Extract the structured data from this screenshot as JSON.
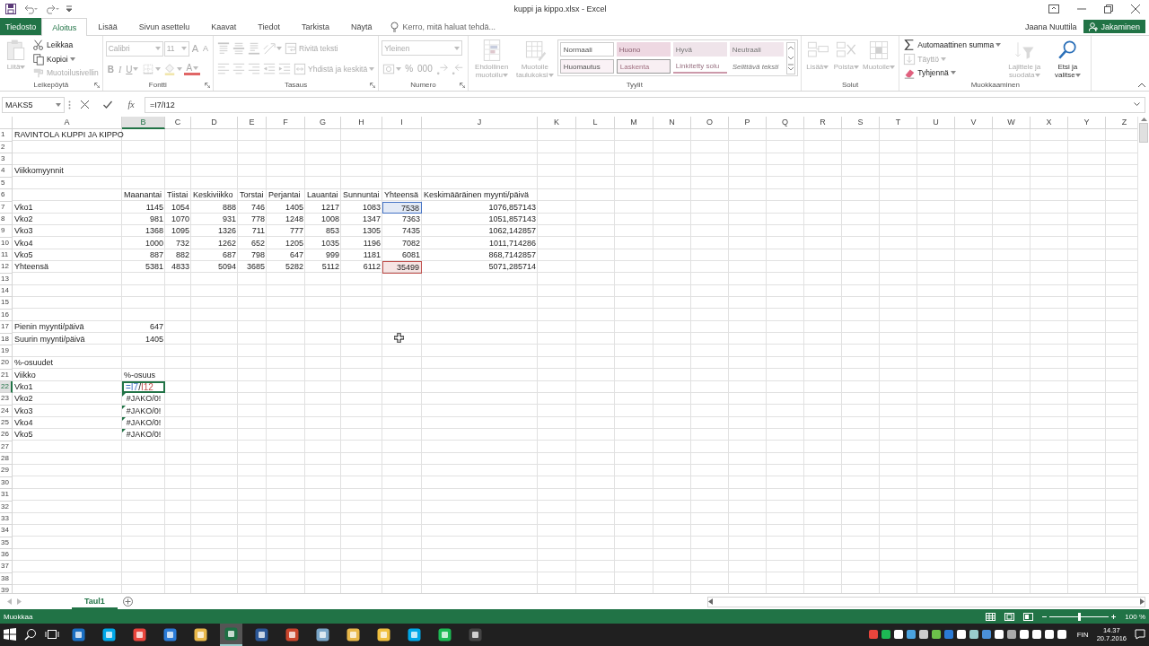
{
  "window": {
    "title": "kuppi ja kippo.xlsx - Excel",
    "user": "Jaana Nuuttila",
    "share_button": "Jakaminen"
  },
  "ribbon_tabs": [
    {
      "label": "Tiedosto",
      "kind": "file",
      "selected": false
    },
    {
      "label": "Aloitus",
      "kind": "tab",
      "selected": true
    },
    {
      "label": "Lisää",
      "kind": "tab",
      "selected": false
    },
    {
      "label": "Sivun asettelu",
      "kind": "tab",
      "selected": false
    },
    {
      "label": "Kaavat",
      "kind": "tab",
      "selected": false
    },
    {
      "label": "Tiedot",
      "kind": "tab",
      "selected": false
    },
    {
      "label": "Tarkista",
      "kind": "tab",
      "selected": false
    },
    {
      "label": "Näytä",
      "kind": "tab",
      "selected": false
    }
  ],
  "tell_me": {
    "placeholder": "Kerro, mitä haluat tehdä..."
  },
  "ribbon_groups": [
    {
      "label": "Leikepöytä",
      "launcher": true,
      "items": [
        {
          "kind": "large",
          "label": "Liitä",
          "disabled": true,
          "dropdown": true
        },
        {
          "kind": "stack",
          "items": [
            {
              "kind": "button",
              "label": "Leikkaa",
              "disabled": false
            },
            {
              "kind": "button",
              "label": "Kopioi",
              "disabled": false,
              "dropdown": true
            },
            {
              "kind": "button",
              "label": "Muotoilusivellin",
              "disabled": true
            }
          ]
        }
      ]
    },
    {
      "label": "Fontti",
      "launcher": true,
      "items": [
        {
          "kind": "stack",
          "items": [
            {
              "kind": "line",
              "items": [
                {
                  "kind": "field",
                  "value": "Calibri",
                  "disabled": true
                },
                {
                  "kind": "field",
                  "value": "11",
                  "disabled": true
                },
                {
                  "kind": "glyph",
                  "text": "A",
                  "disabled": true
                },
                {
                  "kind": "glyph",
                  "text": "A",
                  "disabled": true
                }
              ]
            },
            {
              "kind": "line",
              "items": [
                {
                  "kind": "glyph",
                  "text": "B",
                  "disabled": true
                },
                {
                  "kind": "glyph",
                  "text": "I",
                  "disabled": true
                },
                {
                  "kind": "glyph",
                  "text": "U",
                  "disabled": true,
                  "dropdown": true
                },
                {
                  "kind": "icon",
                  "disabled": true,
                  "dropdown": true
                },
                {
                  "kind": "icon",
                  "disabled": true,
                  "dropdown": true
                },
                {
                  "kind": "glyph",
                  "text": "A",
                  "disabled": true,
                  "dropdown": true
                }
              ]
            }
          ]
        }
      ]
    },
    {
      "label": "Tasaus",
      "launcher": true,
      "items": [
        {
          "kind": "stack",
          "items": [
            {
              "kind": "line",
              "items": [
                {
                  "kind": "icon",
                  "disabled": true
                },
                {
                  "kind": "icon",
                  "disabled": true
                },
                {
                  "kind": "icon",
                  "disabled": true
                },
                {
                  "kind": "icon",
                  "disabled": true,
                  "dropdown": true
                },
                {
                  "kind": "button",
                  "label": "Rivitä teksti",
                  "disabled": true
                }
              ]
            },
            {
              "kind": "line",
              "items": [
                {
                  "kind": "icon",
                  "disabled": true
                },
                {
                  "kind": "icon",
                  "disabled": true
                },
                {
                  "kind": "icon",
                  "disabled": true
                },
                {
                  "kind": "icon",
                  "disabled": true
                },
                {
                  "kind": "icon",
                  "disabled": true
                },
                {
                  "kind": "button",
                  "label": "Yhdistä ja keskitä",
                  "disabled": true,
                  "dropdown": true
                }
              ]
            }
          ]
        }
      ]
    },
    {
      "label": "Numero",
      "launcher": true,
      "items": [
        {
          "kind": "stack",
          "items": [
            {
              "kind": "line",
              "items": [
                {
                  "kind": "field",
                  "value": "Yleinen",
                  "disabled": true
                }
              ]
            },
            {
              "kind": "line",
              "items": [
                {
                  "kind": "icon",
                  "disabled": true,
                  "dropdown": true
                },
                {
                  "kind": "glyph",
                  "text": "%",
                  "disabled": true
                },
                {
                  "kind": "glyph",
                  "text": "000",
                  "disabled": true
                },
                {
                  "kind": "icon",
                  "disabled": true
                },
                {
                  "kind": "icon",
                  "disabled": true
                }
              ]
            }
          ]
        }
      ]
    },
    {
      "label": "Tyylit",
      "items": [
        {
          "kind": "large",
          "label": "Ehdollinen muotoilu",
          "disabled": true,
          "dropdown": true
        },
        {
          "kind": "large",
          "label": "Muotoile taulukoksi",
          "disabled": true,
          "dropdown": true
        },
        {
          "kind": "gallery",
          "styles": [
            {
              "kind": "normal",
              "label": "Normaali"
            },
            {
              "kind": "bad",
              "label": "Huono"
            },
            {
              "kind": "good",
              "label": "Hyvä"
            },
            {
              "kind": "neutral",
              "label": "Neutraali"
            },
            {
              "kind": "note",
              "label": "Huomautus"
            },
            {
              "kind": "calc",
              "label": "Laskenta"
            },
            {
              "kind": "linked",
              "label": "Linkitetty solu"
            },
            {
              "kind": "explanatory",
              "label": "Selittävä teksti"
            }
          ]
        }
      ]
    },
    {
      "label": "Solut",
      "items": [
        {
          "kind": "large",
          "label": "Lisää",
          "disabled": true,
          "dropdown": true
        },
        {
          "kind": "large",
          "label": "Poista",
          "disabled": true,
          "dropdown": true
        },
        {
          "kind": "large",
          "label": "Muotoile",
          "disabled": true,
          "dropdown": true
        }
      ]
    },
    {
      "label": "Muokkaaminen",
      "items": [
        {
          "kind": "stack",
          "items": [
            {
              "kind": "button",
              "label": "Automaattinen summa",
              "disabled": false,
              "dropdown": true
            },
            {
              "kind": "button",
              "label": "Täyttö",
              "disabled": true,
              "dropdown": true
            },
            {
              "kind": "button",
              "label": "Tyhjennä",
              "disabled": false,
              "dropdown": true
            }
          ]
        },
        {
          "kind": "large",
          "label": "Lajittele ja suodata",
          "disabled": true,
          "dropdown": true
        },
        {
          "kind": "large",
          "label": "Etsi ja valitse",
          "disabled": false,
          "dropdown": true
        }
      ]
    }
  ],
  "formula_bar": {
    "name_box": "MAKS5",
    "function_button": "fx",
    "formula": "=I7/I12"
  },
  "columns": [
    {
      "label": "A",
      "selected": false
    },
    {
      "label": "B",
      "selected": true
    },
    {
      "label": "C",
      "selected": false
    },
    {
      "label": "D",
      "selected": false
    },
    {
      "label": "E",
      "selected": false
    },
    {
      "label": "F",
      "selected": false
    },
    {
      "label": "G",
      "selected": false
    },
    {
      "label": "H",
      "selected": false
    },
    {
      "label": "I",
      "selected": false
    },
    {
      "label": "J",
      "selected": false
    },
    {
      "label": "K",
      "selected": false
    },
    {
      "label": "L",
      "selected": false
    },
    {
      "label": "M",
      "selected": false
    },
    {
      "label": "N",
      "selected": false
    },
    {
      "label": "O",
      "selected": false
    },
    {
      "label": "P",
      "selected": false
    },
    {
      "label": "Q",
      "selected": false
    },
    {
      "label": "R",
      "selected": false
    },
    {
      "label": "S",
      "selected": false
    },
    {
      "label": "T",
      "selected": false
    },
    {
      "label": "U",
      "selected": false
    },
    {
      "label": "V",
      "selected": false
    },
    {
      "label": "W",
      "selected": false
    },
    {
      "label": "X",
      "selected": false
    },
    {
      "label": "Y",
      "selected": false
    },
    {
      "label": "Z",
      "selected": false
    }
  ],
  "rows": [
    {
      "number": "1",
      "selected": false,
      "cells": [
        {
          "kind": "text",
          "text": "RAVINTOLA KUPPI JA KIPPO"
        }
      ]
    },
    {
      "number": "2",
      "selected": false
    },
    {
      "number": "3",
      "selected": false
    },
    {
      "number": "4",
      "selected": false,
      "cells": [
        {
          "kind": "text",
          "text": "Viikkomyynnit"
        }
      ]
    },
    {
      "number": "5",
      "selected": false
    },
    {
      "number": "6",
      "selected": false,
      "cells": [
        null,
        {
          "kind": "text",
          "text": "Maanantai"
        },
        {
          "kind": "text",
          "text": "Tiistai"
        },
        {
          "kind": "text",
          "text": "Keskiviikko"
        },
        {
          "kind": "text",
          "text": "Torstai"
        },
        {
          "kind": "text",
          "text": "Perjantai"
        },
        {
          "kind": "text",
          "text": "Lauantai"
        },
        {
          "kind": "text",
          "text": "Sunnuntai"
        },
        {
          "kind": "text",
          "text": "Yhteensä"
        },
        {
          "kind": "text",
          "text": "Keskimääräinen myynti/päivä"
        }
      ]
    },
    {
      "number": "7",
      "selected": false,
      "cells": [
        {
          "kind": "text",
          "text": "Vko1"
        },
        {
          "kind": "number",
          "text": "1145"
        },
        {
          "kind": "number",
          "text": "1054"
        },
        {
          "kind": "number",
          "text": "888"
        },
        {
          "kind": "number",
          "text": "746"
        },
        {
          "kind": "number",
          "text": "1405"
        },
        {
          "kind": "number",
          "text": "1217"
        },
        {
          "kind": "number",
          "text": "1083"
        },
        {
          "kind": "number",
          "text": "7538",
          "color": "#4472c4"
        },
        {
          "kind": "number",
          "text": "1076,857143"
        }
      ]
    },
    {
      "number": "8",
      "selected": false,
      "cells": [
        {
          "kind": "text",
          "text": "Vko2"
        },
        {
          "kind": "number",
          "text": "981"
        },
        {
          "kind": "number",
          "text": "1070"
        },
        {
          "kind": "number",
          "text": "931"
        },
        {
          "kind": "number",
          "text": "778"
        },
        {
          "kind": "number",
          "text": "1248"
        },
        {
          "kind": "number",
          "text": "1008"
        },
        {
          "kind": "number",
          "text": "1347"
        },
        {
          "kind": "number",
          "text": "7363"
        },
        {
          "kind": "number",
          "text": "1051,857143"
        }
      ]
    },
    {
      "number": "9",
      "selected": false,
      "cells": [
        {
          "kind": "text",
          "text": "Vko3"
        },
        {
          "kind": "number",
          "text": "1368"
        },
        {
          "kind": "number",
          "text": "1095"
        },
        {
          "kind": "number",
          "text": "1326"
        },
        {
          "kind": "number",
          "text": "711"
        },
        {
          "kind": "number",
          "text": "777"
        },
        {
          "kind": "number",
          "text": "853"
        },
        {
          "kind": "number",
          "text": "1305"
        },
        {
          "kind": "number",
          "text": "7435"
        },
        {
          "kind": "number",
          "text": "1062,142857"
        }
      ]
    },
    {
      "number": "10",
      "selected": false,
      "cells": [
        {
          "kind": "text",
          "text": "Vko4"
        },
        {
          "kind": "number",
          "text": "1000"
        },
        {
          "kind": "number",
          "text": "732"
        },
        {
          "kind": "number",
          "text": "1262"
        },
        {
          "kind": "number",
          "text": "652"
        },
        {
          "kind": "number",
          "text": "1205"
        },
        {
          "kind": "number",
          "text": "1035"
        },
        {
          "kind": "number",
          "text": "1196"
        },
        {
          "kind": "number",
          "text": "7082"
        },
        {
          "kind": "number",
          "text": "1011,714286"
        }
      ]
    },
    {
      "number": "11",
      "selected": false,
      "cells": [
        {
          "kind": "text",
          "text": "Vko5"
        },
        {
          "kind": "number",
          "text": "887"
        },
        {
          "kind": "number",
          "text": "882"
        },
        {
          "kind": "number",
          "text": "687"
        },
        {
          "kind": "number",
          "text": "798"
        },
        {
          "kind": "number",
          "text": "647"
        },
        {
          "kind": "number",
          "text": "999"
        },
        {
          "kind": "number",
          "text": "1181"
        },
        {
          "kind": "number",
          "text": "6081"
        },
        {
          "kind": "number",
          "text": "868,7142857"
        }
      ]
    },
    {
      "number": "12",
      "selected": false,
      "cells": [
        {
          "kind": "text",
          "text": "Yhteensä"
        },
        {
          "kind": "number",
          "text": "5381"
        },
        {
          "kind": "number",
          "text": "4833"
        },
        {
          "kind": "number",
          "text": "5094"
        },
        {
          "kind": "number",
          "text": "3685"
        },
        {
          "kind": "number",
          "text": "5282"
        },
        {
          "kind": "number",
          "text": "5112"
        },
        {
          "kind": "number",
          "text": "6112"
        },
        {
          "kind": "number",
          "text": "35499",
          "color": "#c0504d"
        },
        {
          "kind": "number",
          "text": "5071,285714"
        }
      ]
    },
    {
      "number": "13",
      "selected": false
    },
    {
      "number": "14",
      "selected": false
    },
    {
      "number": "15",
      "selected": false
    },
    {
      "number": "16",
      "selected": false
    },
    {
      "number": "17",
      "selected": false,
      "cells": [
        {
          "kind": "text",
          "text": "Pienin myynti/päivä"
        },
        {
          "kind": "number",
          "text": "647"
        }
      ]
    },
    {
      "number": "18",
      "selected": false,
      "cells": [
        {
          "kind": "text",
          "text": "Suurin myynti/päivä"
        },
        {
          "kind": "number",
          "text": "1405"
        }
      ]
    },
    {
      "number": "19",
      "selected": false
    },
    {
      "number": "20",
      "selected": false,
      "cells": [
        {
          "kind": "text",
          "text": "%-osuudet"
        }
      ]
    },
    {
      "number": "21",
      "selected": false,
      "cells": [
        {
          "kind": "text",
          "text": "Viikko"
        },
        {
          "kind": "text",
          "text": "%-osuus"
        }
      ]
    },
    {
      "number": "22",
      "selected": true,
      "cells": [
        {
          "kind": "text",
          "text": "Vko1"
        },
        {
          "kind": "edit",
          "parts": [
            {
              "text": "=I7",
              "color": "#4472c4"
            },
            {
              "text": "/"
            },
            {
              "text": "I12",
              "color": "#c0504d"
            }
          ]
        }
      ]
    },
    {
      "number": "23",
      "selected": false,
      "cells": [
        {
          "kind": "text",
          "text": "Vko2"
        },
        {
          "kind": "error",
          "text": "#JAKO/0!"
        }
      ]
    },
    {
      "number": "24",
      "selected": false,
      "cells": [
        {
          "kind": "text",
          "text": "Vko3"
        },
        {
          "kind": "error",
          "text": "#JAKO/0!"
        }
      ]
    },
    {
      "number": "25",
      "selected": false,
      "cells": [
        {
          "kind": "text",
          "text": "Vko4"
        },
        {
          "kind": "error",
          "text": "#JAKO/0!"
        }
      ]
    },
    {
      "number": "26",
      "selected": false,
      "cells": [
        {
          "kind": "text",
          "text": "Vko5"
        },
        {
          "kind": "error",
          "text": "#JAKO/0!"
        }
      ]
    },
    {
      "number": "27",
      "selected": false
    },
    {
      "number": "28",
      "selected": false
    },
    {
      "number": "29",
      "selected": false
    },
    {
      "number": "30",
      "selected": false
    },
    {
      "number": "31",
      "selected": false
    },
    {
      "number": "32",
      "selected": false
    },
    {
      "number": "33",
      "selected": false
    },
    {
      "number": "34",
      "selected": false
    },
    {
      "number": "35",
      "selected": false
    },
    {
      "number": "36",
      "selected": false
    },
    {
      "number": "37",
      "selected": false
    },
    {
      "number": "38",
      "selected": false
    },
    {
      "number": "39",
      "selected": false
    }
  ],
  "sheet_tabs": [
    {
      "label": "Taul1",
      "selected": true
    }
  ],
  "status_bar": {
    "mode": "Muokkaa",
    "zoom_slider": {
      "level": 0.5
    },
    "zoom": "100 %"
  },
  "taskbar": {
    "apps": [
      {
        "selected": false
      },
      {
        "selected": false
      },
      {
        "selected": false
      },
      {
        "selected": false
      },
      {
        "selected": false
      },
      {
        "selected": true
      },
      {
        "selected": false
      },
      {
        "selected": false
      },
      {
        "selected": false
      },
      {
        "selected": false
      },
      {
        "selected": false
      },
      {
        "selected": false
      },
      {
        "selected": false
      },
      {
        "selected": false
      }
    ],
    "language": "FIN",
    "time": "14.37",
    "date": "20.7.2016"
  }
}
